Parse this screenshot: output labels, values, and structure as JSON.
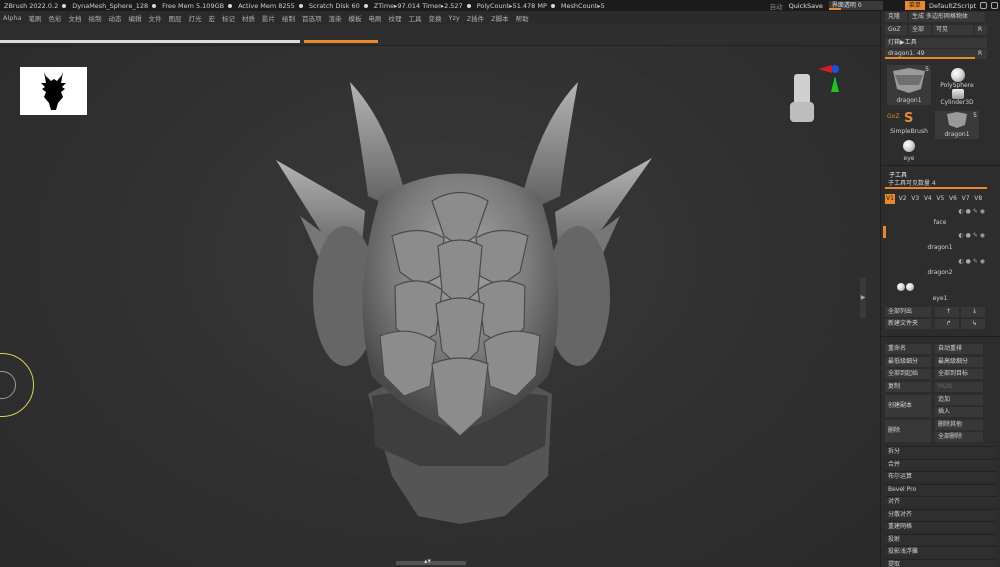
{
  "titlebar": {
    "app": "ZBrush 2022.0.2",
    "mesh": "DynaMesh_Sphere_128",
    "stats": [
      "Free Mem 5.109GB",
      "Active Mem 8255",
      "Scratch Disk 60",
      "ZTime▸97.014 Timer▸2.527",
      "PolyCount▸51.478 MP",
      "MeshCount▸5"
    ],
    "autosave": "自动",
    "quicksave": "QuickSave",
    "transparency": "界面透明 0",
    "menu_label": "菜单",
    "script": "DefaultZScript"
  },
  "menubar": [
    "Alpha",
    "笔刷",
    "色彩",
    "文档",
    "绘制",
    "动态",
    "编辑",
    "文件",
    "图层",
    "灯光",
    "宏",
    "标记",
    "材质",
    "影片",
    "绘制",
    "首选项",
    "渲染",
    "模板",
    "电刷",
    "纹理",
    "工具",
    "变换",
    "Yzy",
    "Z插件",
    "Z脚本",
    "帮助"
  ],
  "panel": {
    "top_buttons": [
      "克隆",
      "生成 多边形网格物体"
    ],
    "goz_row": [
      "GoZ",
      "全部",
      "可见",
      "R"
    ],
    "lightbox": "灯箱▶工具",
    "current_tool": "dragon1. 49",
    "current_tool_r": "R",
    "tools": [
      {
        "label": "dragon1",
        "count": "5"
      },
      {
        "label": "PolySphere",
        "count": ""
      },
      {
        "label": "Cylinder3D",
        "count": ""
      },
      {
        "label": "SimpleBrush",
        "count": ""
      },
      {
        "label": "dragon1",
        "count": "5"
      },
      {
        "label": "eye",
        "count": ""
      }
    ],
    "goz_icon": "GoZ",
    "subtool_header": "子工具",
    "subtool_visible": "子工具可见数量 4",
    "versions": [
      "V1",
      "V2",
      "V3",
      "V4",
      "V5",
      "V6",
      "V7",
      "V8"
    ],
    "subtools": [
      "face",
      "dragon1",
      "dragon2",
      "eye1"
    ],
    "list_buttons": [
      "全部列出",
      "新建文件夹"
    ],
    "actions": [
      [
        "重命名",
        "自动重排"
      ],
      [
        "最低级细分",
        "最高级细分"
      ],
      [
        "全部到起始",
        "全部到目标"
      ],
      [
        "复制",
        "Multi"
      ]
    ],
    "create_group": {
      "label": "创建副本",
      "items": [
        "追加",
        "插入"
      ]
    },
    "delete_group": {
      "label": "删除",
      "items": [
        "删除其他",
        "全部删除"
      ]
    },
    "sections": [
      "拆分",
      "合并",
      "布尔运算",
      "Bevel Pro",
      "对齐",
      "分散对齐",
      "重建网格",
      "投射",
      "投影浅浮雕",
      "提取"
    ]
  },
  "colors": {
    "accent": "#e8892b",
    "background": "#2a2a2a",
    "panel": "#2d2d2d"
  }
}
